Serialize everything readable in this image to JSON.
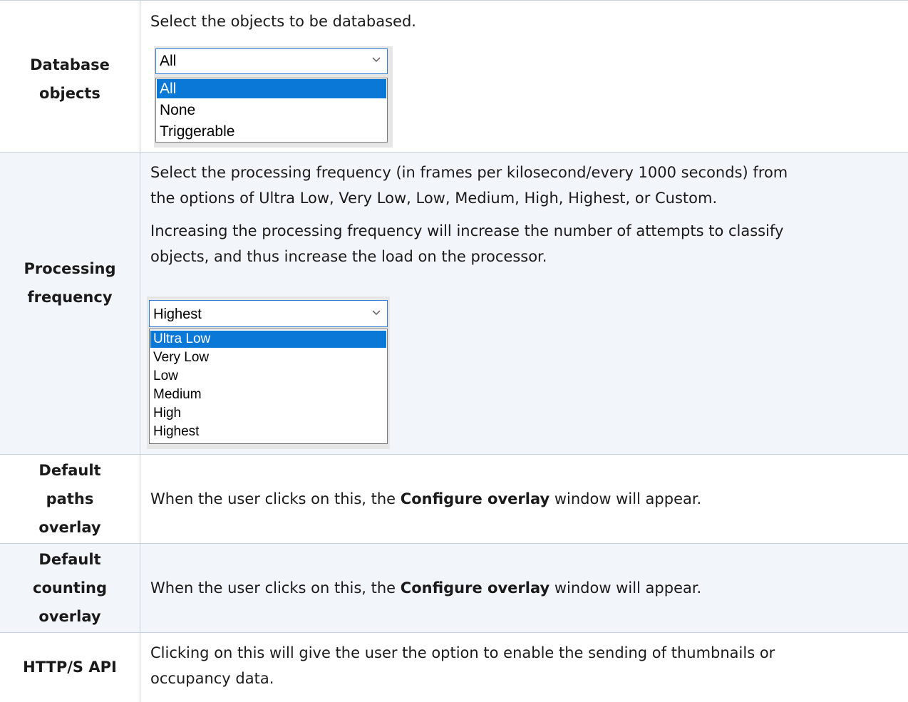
{
  "rows": {
    "database_objects": {
      "label_line1": "Database",
      "label_line2": "objects",
      "description": "Select the objects to be databased.",
      "dropdown": {
        "value": "All",
        "options": [
          "All",
          "None",
          "Triggerable"
        ],
        "selected_index": 0
      }
    },
    "processing_frequency": {
      "label_line1": "Processing",
      "label_line2": "frequency",
      "desc1_line1": "Select the processing frequency (in frames per kilosecond/every 1000 seconds) from",
      "desc1_line2": "the options of Ultra Low, Very Low, Low, Medium, High, Highest, or Custom.",
      "desc2_line1": "Increasing the processing frequency will increase the number of attempts to classify",
      "desc2_line2": "objects, and thus increase the load on the processor.",
      "dropdown": {
        "value": "Highest",
        "options": [
          "Ultra Low",
          "Very Low",
          "Low",
          "Medium",
          "High",
          "Highest"
        ],
        "selected_index": 0
      }
    },
    "default_paths_overlay": {
      "label_line1": "Default",
      "label_line2": "paths",
      "label_line3": "overlay",
      "text_before": "When the user clicks on this, the ",
      "text_bold": "Configure overlay",
      "text_after": " window will appear."
    },
    "default_counting_overlay": {
      "label_line1": "Default",
      "label_line2": "counting",
      "label_line3": "overlay",
      "text_before": "When the user clicks on this, the ",
      "text_bold": "Configure overlay",
      "text_after": " window will appear."
    },
    "http_api": {
      "label": "HTTP/S API",
      "desc_line1": "Clicking on this will give the user the option to enable the sending of thumbnails or",
      "desc_line2": "occupancy data."
    }
  },
  "colors": {
    "row_shade": "#f2f5f9",
    "grid_line": "#c8d1db",
    "selection": "#0a78d7"
  },
  "icons": {
    "dropdown_arrow": "chevron-down-icon"
  }
}
